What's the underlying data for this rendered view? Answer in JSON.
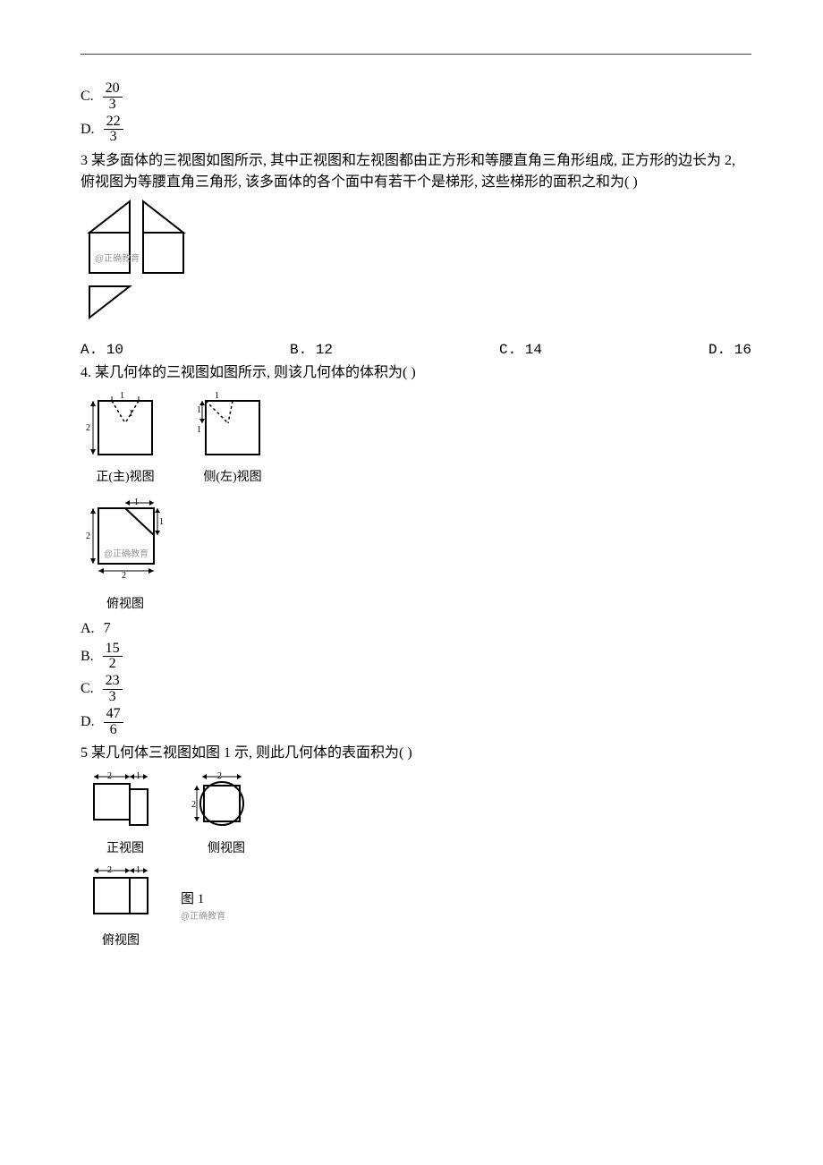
{
  "q2_tail_options": {
    "c": {
      "label": "C.",
      "num": "20",
      "den": "3"
    },
    "d": {
      "label": "D.",
      "num": "22",
      "den": "3"
    }
  },
  "q3": {
    "text": "3 某多面体的三视图如图所示, 其中正视图和左视图都由正方形和等腰直角三角形组成, 正方形的边长为 2, 俯视图为等腰直角三角形, 该多面体的各个面中有若干个是梯形, 这些梯形的面积之和为(          )",
    "watermark": "@正确教育",
    "options": {
      "a": "A. 10",
      "b": "B. 12",
      "c": "C. 14",
      "d": "D. 16"
    }
  },
  "q4": {
    "text": "4. 某几何体的三视图如图所示, 则该几何体的体积为(          )",
    "labels": {
      "front": "正(主)视图",
      "side": "侧(左)视图",
      "top": "俯视图"
    },
    "watermark": "@正确教育",
    "options": {
      "a": {
        "label": "A.",
        "value": "7"
      },
      "b": {
        "label": "B.",
        "num": "15",
        "den": "2"
      },
      "c": {
        "label": "C.",
        "num": "23",
        "den": "3"
      },
      "d": {
        "label": "D.",
        "num": "47",
        "den": "6"
      }
    }
  },
  "q5": {
    "text": "5 某几何体三视图如图 1 示, 则此几何体的表面积为(      )",
    "labels": {
      "front": "正视图",
      "side": "侧视图",
      "top": "俯视图",
      "fig": "图 1"
    },
    "watermark": "@正确教育"
  }
}
